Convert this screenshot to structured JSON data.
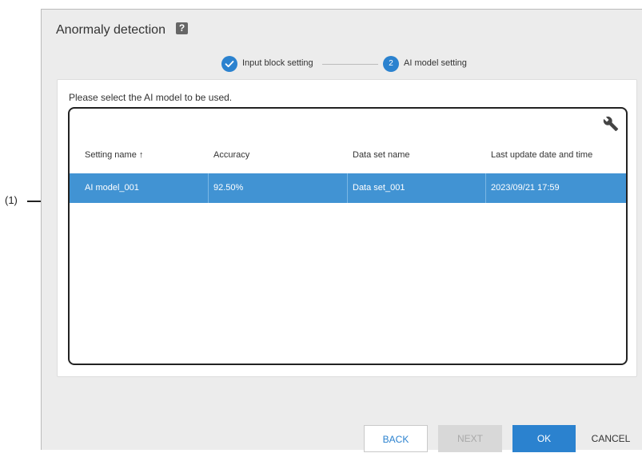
{
  "callout": {
    "label": "(1)"
  },
  "dialog": {
    "title": "Anormaly detection",
    "help_icon": "?",
    "steps": [
      {
        "label": "Input block setting",
        "state": "completed",
        "icon": "check-icon"
      },
      {
        "number": "2",
        "label": "AI model setting",
        "state": "active"
      }
    ],
    "instruction": "Please select the AI model to be used.",
    "table": {
      "columns": [
        "Setting name ↑",
        "Accuracy",
        "Data set name",
        "Last update date and time"
      ],
      "rows": [
        [
          "AI model_001",
          "92.50%",
          "Data set_001",
          "2023/09/21 17:59"
        ]
      ],
      "selected_row": 0
    },
    "buttons": {
      "back": "BACK",
      "next": "NEXT",
      "ok": "OK",
      "cancel": "CANCEL"
    }
  },
  "colors": {
    "accent": "#2b82cf",
    "selected_row": "#4193d3",
    "dialog_bg": "#ececec"
  }
}
